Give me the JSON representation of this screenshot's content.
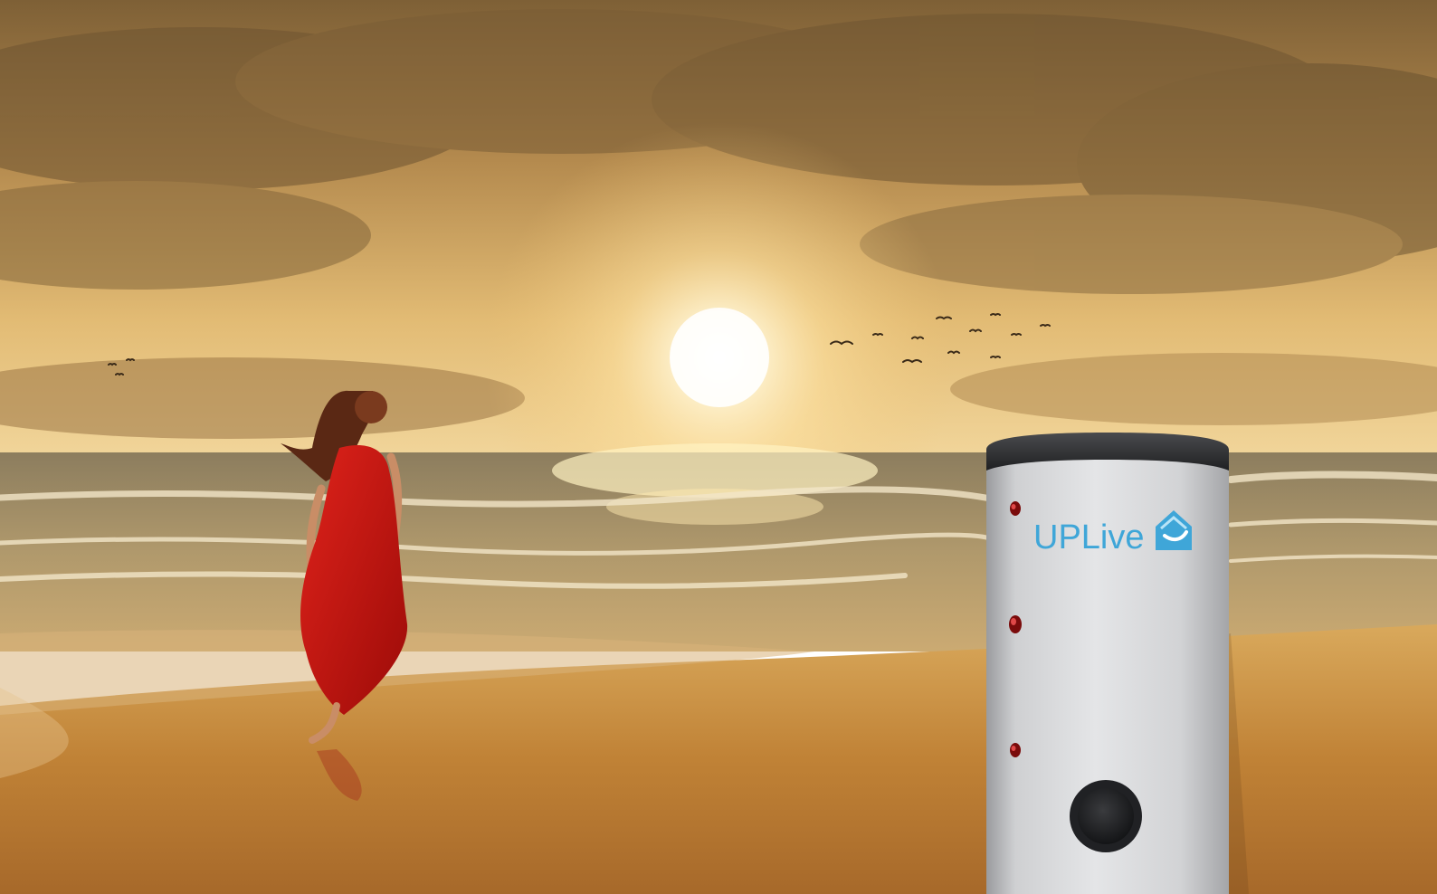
{
  "scene": {
    "brand": {
      "prefix": "UP",
      "suffix": "Live"
    },
    "colors": {
      "sky_top": "#8d6a3a",
      "sky_glow": "#fff3c8",
      "sea": "#9c8a63",
      "sand": "#c58a3c",
      "dress": "#c8130e",
      "tank_body": "#d6d7d9",
      "tank_cap": "#2c2d30",
      "brand_text": "#3fa6d8",
      "indicator": "#8e0d0d"
    },
    "icons": [
      "sun-icon",
      "bird-icon",
      "house-logo-icon"
    ]
  }
}
